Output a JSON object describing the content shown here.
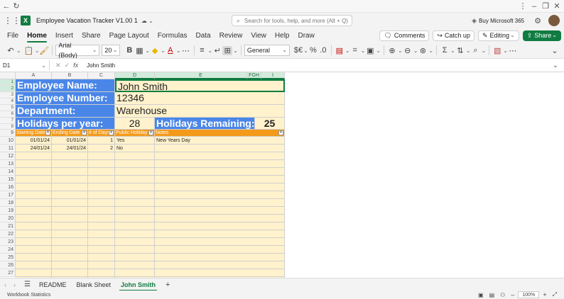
{
  "app": {
    "title": "Employee Vacation Tracker V1.00 1",
    "search_placeholder": "Search for tools, help, and more (Alt + Q)",
    "buy_label": "Buy Microsoft 365"
  },
  "ribbon": {
    "tabs": [
      "File",
      "Home",
      "Insert",
      "Share",
      "Page Layout",
      "Formulas",
      "Data",
      "Review",
      "View",
      "Help",
      "Draw"
    ],
    "comments_label": "Comments",
    "catchup_label": "Catch up",
    "editing_label": "Editing",
    "share_label": "Share"
  },
  "toolbar": {
    "font_name": "Arial (Body)",
    "font_size": "20",
    "number_format": "General",
    "currency_label": "$€"
  },
  "formula": {
    "name_box": "D1",
    "fx_label": "fx",
    "value": "John Smith"
  },
  "grid": {
    "columns": [
      "A",
      "B",
      "C",
      "D",
      "E",
      "FGH",
      "I"
    ],
    "rows": [
      "1",
      "2",
      "3",
      "4",
      "5",
      "6",
      "7",
      "8",
      "9",
      "10",
      "11",
      "12",
      "13",
      "14",
      "15",
      "16",
      "17",
      "18",
      "19",
      "20",
      "21",
      "22",
      "23",
      "24",
      "25",
      "26",
      "27"
    ],
    "employee_name_label": "Employee Name:",
    "employee_name": "John Smith",
    "employee_number_label": "Employee Number:",
    "employee_number": "12346",
    "department_label": "Department:",
    "department": "Warehouse",
    "holidays_per_year_label": "Holidays per year:",
    "holidays_per_year": "28",
    "holidays_remaining_label": "Holidays Remaining:",
    "holidays_remaining": "25",
    "table_headers": [
      "Starting Date",
      "Ending Date",
      "# of Days",
      "Public Holiday",
      "Notes"
    ],
    "table_rows": [
      [
        "01/01/24",
        "01/01/24",
        "1",
        "Yes",
        "New Years Day"
      ],
      [
        "24/01/24",
        "24/01/24",
        "2",
        "No",
        ""
      ]
    ]
  },
  "sheets": {
    "tabs": [
      "README",
      "Blank Sheet",
      "John Smith"
    ],
    "active": "John Smith"
  },
  "status": {
    "left": "Workbook Statistics",
    "zoom": "100%"
  },
  "colors": {
    "accent": "#107c41",
    "label_blue": "#4a86e8",
    "header_orange": "#f49a1b",
    "cream": "#fff2cc"
  }
}
